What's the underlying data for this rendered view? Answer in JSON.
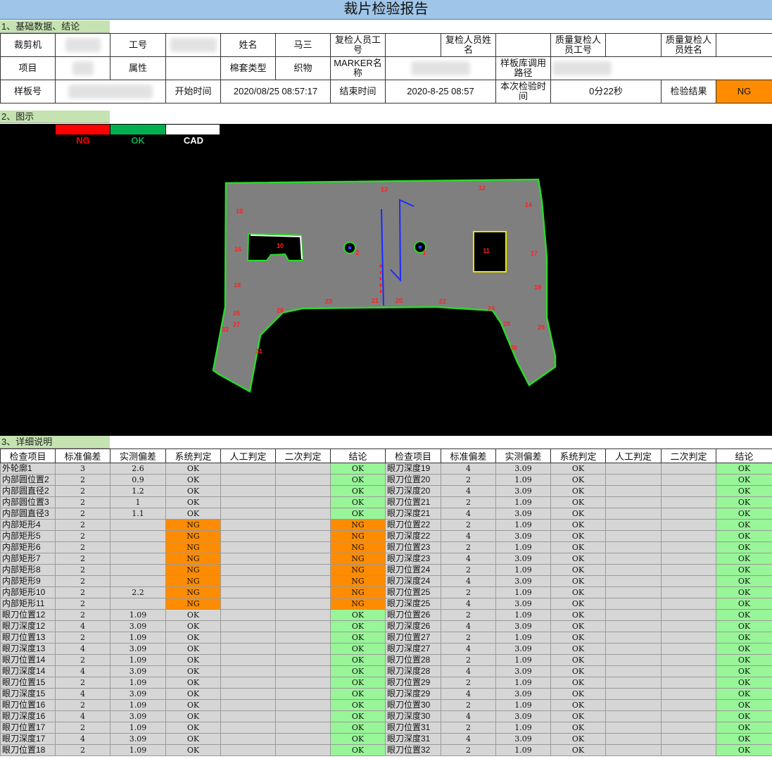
{
  "title": "裁片检验报告",
  "sections": {
    "s1": "1、基础数据、结论",
    "s2": "2、图示",
    "s3": "3、详细说明"
  },
  "info": {
    "machine_label": "裁剪机",
    "worker_id_label": "工号",
    "name_label": "姓名",
    "name_value": "马三",
    "recheck_id_label": "复检人员工号",
    "recheck_name_label": "复检人员姓名",
    "quality_id_label": "质量复检人员工号",
    "quality_name_label": "质量复检人员姓名",
    "project_label": "项目",
    "attr_label": "属性",
    "set_type_label": "棉套类型",
    "set_type_value": "织物",
    "marker_label": "MARKER名称",
    "lib_path_label": "样板库调用路径",
    "sample_no_label": "样板号",
    "start_label": "开始时间",
    "start_value": "2020/08/25 08:57:17",
    "end_label": "结束时间",
    "end_value": "2020-8-25 08:57",
    "duration_label": "本次检验时间",
    "duration_value": "0分22秒",
    "result_label": "检验结果",
    "result_value": "NG"
  },
  "legend": {
    "ng": "NG",
    "ok": "OK",
    "cad": "CAD",
    "ng_color": "#ff0000",
    "ok_color": "#00b050",
    "cad_color": "#ffffff"
  },
  "piece_labels": [
    "13",
    "12",
    "14",
    "15",
    "16",
    "10",
    "2",
    "1",
    "11",
    "17",
    "18",
    "19",
    "23",
    "21",
    "20",
    "22",
    "24",
    "26",
    "25",
    "27",
    "32",
    "28",
    "29",
    "30",
    "31"
  ],
  "detail_headers": [
    "检查项目",
    "标准偏差",
    "实测偏差",
    "系统判定",
    "人工判定",
    "二次判定",
    "结论",
    "检查项目",
    "标准偏差",
    "实测偏差",
    "系统判定",
    "人工判定",
    "二次判定",
    "结论"
  ],
  "rows_left": [
    [
      "外轮廓1",
      "3",
      "2.6",
      "OK",
      "OK"
    ],
    [
      "内部圆位置2",
      "2",
      "0.9",
      "OK",
      "OK"
    ],
    [
      "内部圆直径2",
      "2",
      "1.2",
      "OK",
      "OK"
    ],
    [
      "内部圆位置3",
      "2",
      "1",
      "OK",
      "OK"
    ],
    [
      "内部圆直径3",
      "2",
      "1.1",
      "OK",
      "OK"
    ],
    [
      "内部矩形4",
      "2",
      "",
      "NG",
      "NG"
    ],
    [
      "内部矩形5",
      "2",
      "",
      "NG",
      "NG"
    ],
    [
      "内部矩形6",
      "2",
      "",
      "NG",
      "NG"
    ],
    [
      "内部矩形7",
      "2",
      "",
      "NG",
      "NG"
    ],
    [
      "内部矩形8",
      "2",
      "",
      "NG",
      "NG"
    ],
    [
      "内部矩形9",
      "2",
      "",
      "NG",
      "NG"
    ],
    [
      "内部矩形10",
      "2",
      "2.2",
      "NG",
      "NG"
    ],
    [
      "内部矩形11",
      "2",
      "",
      "NG",
      "NG"
    ],
    [
      "眼刀位置12",
      "2",
      "1.09",
      "OK",
      "OK"
    ],
    [
      "眼刀深度12",
      "4",
      "3.09",
      "OK",
      "OK"
    ],
    [
      "眼刀位置13",
      "2",
      "1.09",
      "OK",
      "OK"
    ],
    [
      "眼刀深度13",
      "4",
      "3.09",
      "OK",
      "OK"
    ],
    [
      "眼刀位置14",
      "2",
      "1.09",
      "OK",
      "OK"
    ],
    [
      "眼刀深度14",
      "4",
      "3.09",
      "OK",
      "OK"
    ],
    [
      "眼刀位置15",
      "2",
      "1.09",
      "OK",
      "OK"
    ],
    [
      "眼刀深度15",
      "4",
      "3.09",
      "OK",
      "OK"
    ],
    [
      "眼刀位置16",
      "2",
      "1.09",
      "OK",
      "OK"
    ],
    [
      "眼刀深度16",
      "4",
      "3.09",
      "OK",
      "OK"
    ],
    [
      "眼刀位置17",
      "2",
      "1.09",
      "OK",
      "OK"
    ],
    [
      "眼刀深度17",
      "4",
      "3.09",
      "OK",
      "OK"
    ],
    [
      "眼刀位置18",
      "2",
      "1.09",
      "OK",
      "OK"
    ]
  ],
  "rows_right": [
    [
      "眼刀深度19",
      "4",
      "3.09",
      "OK",
      "OK"
    ],
    [
      "眼刀位置20",
      "2",
      "1.09",
      "OK",
      "OK"
    ],
    [
      "眼刀深度20",
      "4",
      "3.09",
      "OK",
      "OK"
    ],
    [
      "眼刀位置21",
      "2",
      "1.09",
      "OK",
      "OK"
    ],
    [
      "眼刀深度21",
      "4",
      "3.09",
      "OK",
      "OK"
    ],
    [
      "眼刀位置22",
      "2",
      "1.09",
      "OK",
      "OK"
    ],
    [
      "眼刀深度22",
      "4",
      "3.09",
      "OK",
      "OK"
    ],
    [
      "眼刀位置23",
      "2",
      "1.09",
      "OK",
      "OK"
    ],
    [
      "眼刀深度23",
      "4",
      "3.09",
      "OK",
      "OK"
    ],
    [
      "眼刀位置24",
      "2",
      "1.09",
      "OK",
      "OK"
    ],
    [
      "眼刀深度24",
      "4",
      "3.09",
      "OK",
      "OK"
    ],
    [
      "眼刀位置25",
      "2",
      "1.09",
      "OK",
      "OK"
    ],
    [
      "眼刀深度25",
      "4",
      "3.09",
      "OK",
      "OK"
    ],
    [
      "眼刀位置26",
      "2",
      "1.09",
      "OK",
      "OK"
    ],
    [
      "眼刀深度26",
      "4",
      "3.09",
      "OK",
      "OK"
    ],
    [
      "眼刀位置27",
      "2",
      "1.09",
      "OK",
      "OK"
    ],
    [
      "眼刀深度27",
      "4",
      "3.09",
      "OK",
      "OK"
    ],
    [
      "眼刀位置28",
      "2",
      "1.09",
      "OK",
      "OK"
    ],
    [
      "眼刀深度28",
      "4",
      "3.09",
      "OK",
      "OK"
    ],
    [
      "眼刀位置29",
      "2",
      "1.09",
      "OK",
      "OK"
    ],
    [
      "眼刀深度29",
      "4",
      "3.09",
      "OK",
      "OK"
    ],
    [
      "眼刀位置30",
      "2",
      "1.09",
      "OK",
      "OK"
    ],
    [
      "眼刀深度30",
      "4",
      "3.09",
      "OK",
      "OK"
    ],
    [
      "眼刀位置31",
      "2",
      "1.09",
      "OK",
      "OK"
    ],
    [
      "眼刀深度31",
      "4",
      "3.09",
      "OK",
      "OK"
    ],
    [
      "眼刀位置32",
      "2",
      "1.09",
      "OK",
      "OK"
    ]
  ]
}
